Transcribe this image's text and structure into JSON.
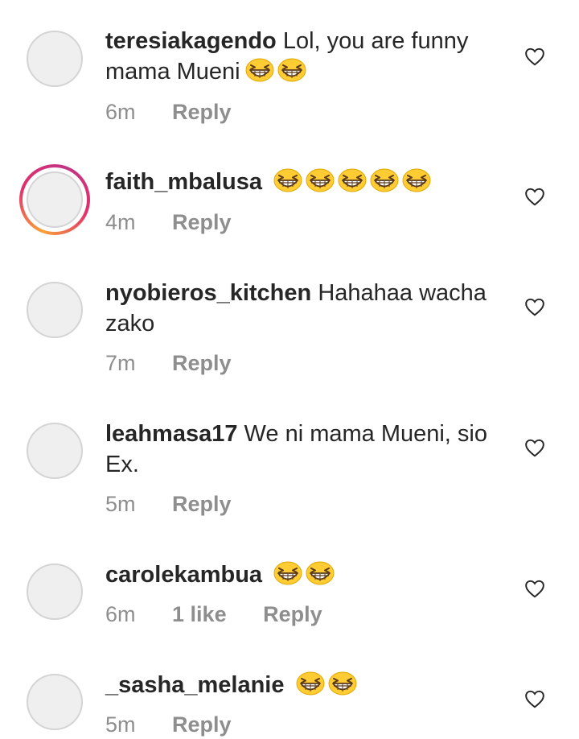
{
  "comments": [
    {
      "username": "teresiakagendo",
      "text": "Lol, you are funny mama Mueni",
      "emojis": 2,
      "time": "6m",
      "likes": "",
      "reply": "Reply",
      "story": false
    },
    {
      "username": "faith_mbalusa",
      "text": "",
      "emojis": 5,
      "time": "4m",
      "likes": "",
      "reply": "Reply",
      "story": true
    },
    {
      "username": "nyobieros_kitchen",
      "text": "Hahahaa wacha zako",
      "emojis": 0,
      "time": "7m",
      "likes": "",
      "reply": "Reply",
      "story": false
    },
    {
      "username": "leahmasa17",
      "text": "We ni mama Mueni, sio Ex.",
      "emojis": 0,
      "time": "5m",
      "likes": "",
      "reply": "Reply",
      "story": false
    },
    {
      "username": "carolekambua",
      "text": "",
      "emojis": 2,
      "time": "6m",
      "likes": "1 like",
      "reply": "Reply",
      "story": false
    },
    {
      "username": "_sasha_melanie",
      "text": "",
      "emojis": 2,
      "time": "5m",
      "likes": "",
      "reply": "Reply",
      "story": false
    }
  ],
  "colors": {
    "text": "#262626",
    "meta": "#8e8e8e",
    "emoji_face": "#ffcc33"
  },
  "icons": {
    "like": "heart-outline-icon",
    "emoji": "grinning-squinting-face-icon"
  }
}
